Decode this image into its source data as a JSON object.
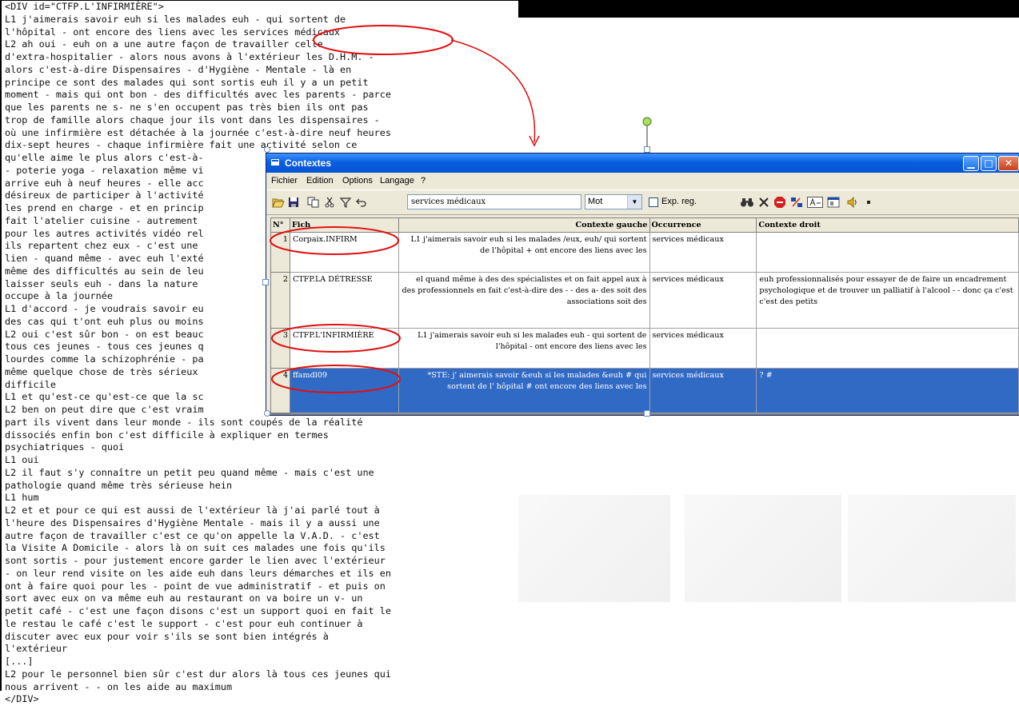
{
  "document": {
    "lines": [
      "<DIV id=\"CTFP.L'INFIRMIÈRE\">",
      "L1 j'aimerais savoir euh si les malades euh - qui sortent de",
      "l'hôpital - ont encore des liens avec les services médicaux",
      "L2 ah oui - euh on a une autre façon de travailler celle",
      "d'extra-hospitalier - alors nous avons à l'extérieur les D.H.M. -",
      "alors c'est-à-dire Dispensaires - d'Hygiène - Mentale - là en",
      "principe ce sont des malades qui sont sortis euh il y a un petit",
      "moment - mais qui ont bon - des difficultés avec les parents - parce",
      "que les parents ne s- ne s'en occupent pas très bien ils ont pas",
      "trop de famille alors chaque jour ils vont dans les dispensaires -",
      "où une infirmière est détachée à la journée c'est-à-dire neuf heures",
      "dix-sept heures - chaque infirmière fait une activité selon ce",
      "qu'elle aime le plus alors c'est-à-",
      "- poterie yoga - relaxation même vi",
      "arrive euh à neuf heures - elle acc",
      "désireux de participer à l'activité",
      "les prend en charge - et en princip",
      "fait l'atelier cuisine - autrement",
      "pour les autres activités vidéo rel",
      "ils repartent chez eux - c'est une",
      "lien - quand même - avec euh l'exté",
      "même des difficultés au sein de leu",
      "laisser seuls euh - dans la nature",
      "occupe à la journée",
      "L1 d'accord - je voudrais savoir eu",
      "des cas qui t'ont euh plus ou moins",
      "L2 oui c'est sûr bon - on est beauc",
      "tous ces jeunes - tous ces jeunes q",
      "lourdes comme la schizophrénie - pa",
      "même quelque chose de très sérieux",
      "difficile",
      "L1 et qu'est-ce qu'est-ce que la sc",
      "L2 ben on peut dire que c'est vraim",
      "part ils vivent dans leur monde - ils sont coupés de la réalité",
      "dissociés enfin bon c'est difficile à expliquer en termes",
      "psychiatriques - quoi",
      "L1 oui",
      "L2 il faut s'y connaître un petit peu quand même - mais c'est une",
      "pathologie quand même très sérieuse hein",
      "L1 hum",
      "L2 et et pour ce qui est aussi de l'extérieur là j'ai parlé tout à",
      "l'heure des Dispensaires d'Hygiène Mentale - mais il y a aussi une",
      "autre façon de travailler c'est ce qu'on appelle la V.A.D. - c'est",
      "la Visite A Domicile - alors là on suit ces malades une fois qu'ils",
      "sont sortis - pour justement encore garder le lien avec l'extérieur",
      "- on leur rend visite on les aide euh dans leurs démarches et ils en",
      "ont à faire quoi pour les - point de vue administratif - et puis on",
      "sort avec eux on va même euh au restaurant on va boire un v- un",
      "petit café - c'est une façon disons c'est un support quoi en fait le",
      "le restau le café c'est le support - c'est pour euh continuer à",
      "discuter avec eux pour voir s'ils se sont bien intégrés à",
      "l'extérieur",
      "[...]",
      "L2 pour le personnel bien sûr c'est dur alors là tous ces jeunes qui",
      "nous arrivent - - on les aide au maximum",
      "</DIV>"
    ]
  },
  "window": {
    "title": "Contextes",
    "menu": [
      "Fichier",
      "Edition",
      "Options",
      "Langage",
      "?"
    ],
    "search_value": "services médicaux",
    "mode_value": "Mot",
    "regex_label": "Exp. reg.",
    "regex_checked": false
  },
  "grid": {
    "columns": [
      "N°",
      "Fich",
      "Contexte gauche",
      "Occurrence",
      "Contexte droit"
    ],
    "rows": [
      {
        "n": "1",
        "file": "Corpaix.INFIRM",
        "left": "L1 j'aimerais savoir euh si les malades /eux, euh/ qui sortent de l'hôpital + ont encore des liens avec les",
        "occ": "services médicaux",
        "right": ""
      },
      {
        "n": "2",
        "file": "CTFP.LA DÉTRESSE",
        "left": "el quand même à des des spécialistes et on fait appel aux à des professionnels en fait c'est-à-dire des - - des a- des soit des associations soit des",
        "occ": "services médicaux",
        "right": "euh professionnalisés pour essayer de de faire un encadrement psychologique et de trouver un palliatif à l'alcool - - donc ça c'est c'est des petits"
      },
      {
        "n": "3",
        "file": "CTFP.L'INFIRMIÈRE",
        "left": "L1 j'aimerais savoir euh si les malades euh - qui sortent de l'hôpital - ont encore des liens avec les",
        "occ": "services médicaux",
        "right": ""
      },
      {
        "n": "4",
        "file": "ffamdl09",
        "left": "*STE: j' aimerais savoir &euh si les malades &euh # qui sortent de l' hôpital # ont encore des liens avec les",
        "occ": "services médicaux",
        "right": "? #"
      }
    ]
  },
  "icons": {
    "open": "folder-open-icon",
    "save": "save-icon",
    "copy": "copy-icon",
    "cut": "cut-icon",
    "filter": "filter-icon",
    "undo": "undo-icon",
    "binoculars": "binoculars-icon",
    "clear": "clear-x-icon",
    "stop": "stop-icon",
    "sort": "sort-icon",
    "font": "font-icon",
    "properties": "properties-icon",
    "sound": "speaker-icon",
    "record": "record-icon"
  },
  "colors": {
    "selection": "#316ac5",
    "annotation": "#e01010",
    "titlebar": "#0a5fe0"
  }
}
